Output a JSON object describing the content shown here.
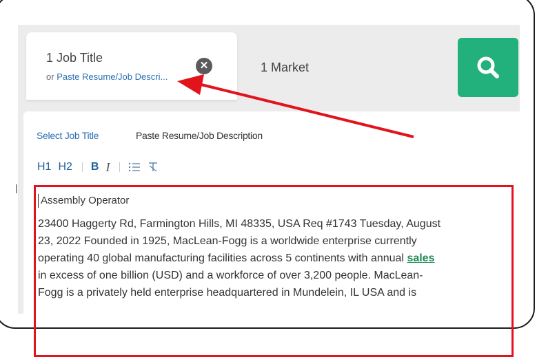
{
  "search": {
    "job_title": "1 Job Title",
    "job_sub_prefix": "or",
    "job_sub_link": "Paste Resume/Job Descri...",
    "clear_icon": "close-circle-icon",
    "market": "1 Market",
    "search_icon": "search-icon"
  },
  "tabs": {
    "select": "Select Job Title",
    "paste": "Paste Resume/Job Description"
  },
  "toolbar": {
    "h1": "H1",
    "h2": "H2",
    "bold": "B",
    "italic": "I",
    "list_icon": "list-icon",
    "clear_format_icon": "clear-format-icon"
  },
  "editor": {
    "title": "Assembly Operator",
    "line1": "23400 Haggerty Rd, Farmington Hills, MI 48335, USA Req #1743 Tuesday, August",
    "line2": "23, 2022 Founded in 1925, MacLean-Fogg is a worldwide enterprise currently",
    "line3_a": "operating 40 global manufacturing facilities across 5 continents with annual",
    "line3_hl": "sales",
    "line4": "in excess of one billion (USD) and a workforce of over 3,200 people. MacLean-",
    "line5": "Fogg is a privately held enterprise headquartered in Mundelein, IL USA and is"
  },
  "colors": {
    "accent_green": "#22b07d",
    "link_blue": "#2a6fb0",
    "annotation_red": "#e2131b"
  }
}
